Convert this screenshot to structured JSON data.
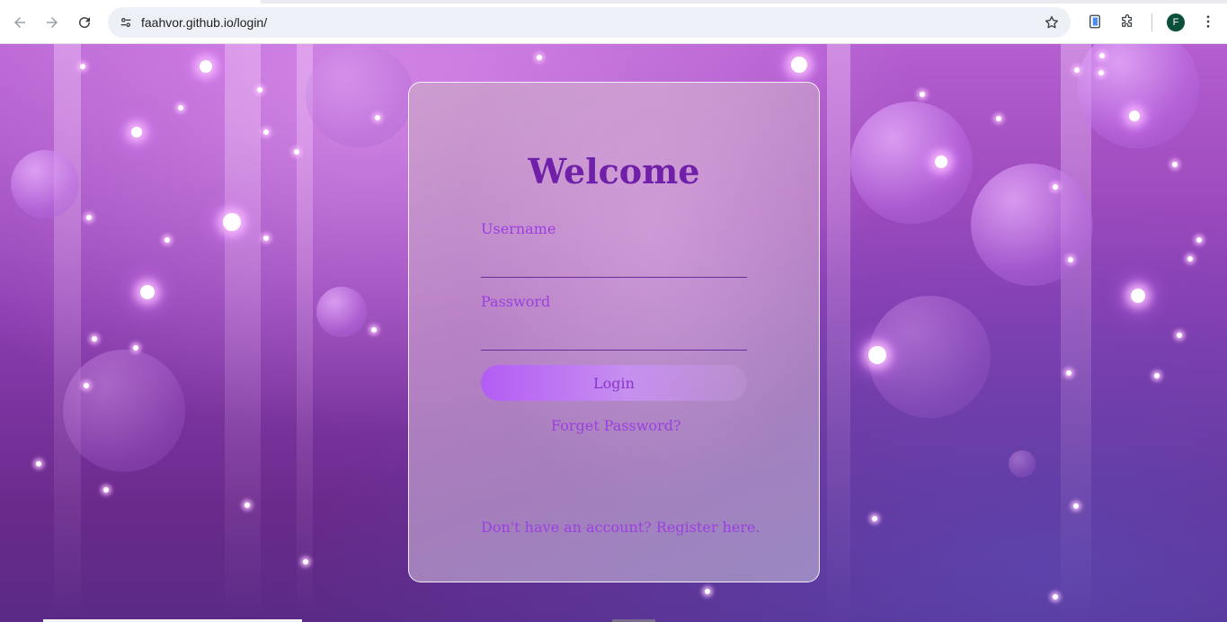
{
  "browser": {
    "url": "faahvor.github.io/login/",
    "profile_initial": "F",
    "icons": [
      "back-icon",
      "forward-icon",
      "reload-icon",
      "site-info-icon",
      "bookmark-star-icon",
      "reading-mode-icon",
      "extensions-icon",
      "profile-avatar",
      "more-menu-icon"
    ]
  },
  "login": {
    "title": "Welcome",
    "username_label": "Username",
    "username_value": "",
    "password_label": "Password",
    "password_value": "",
    "login_button": "Login",
    "forgot_link": "Forget Password?",
    "register_link": "Don't have an account? Register here."
  },
  "colors": {
    "accent": "#9b3fe0",
    "title": "#6f1fa8",
    "button": "#b45cf5"
  }
}
